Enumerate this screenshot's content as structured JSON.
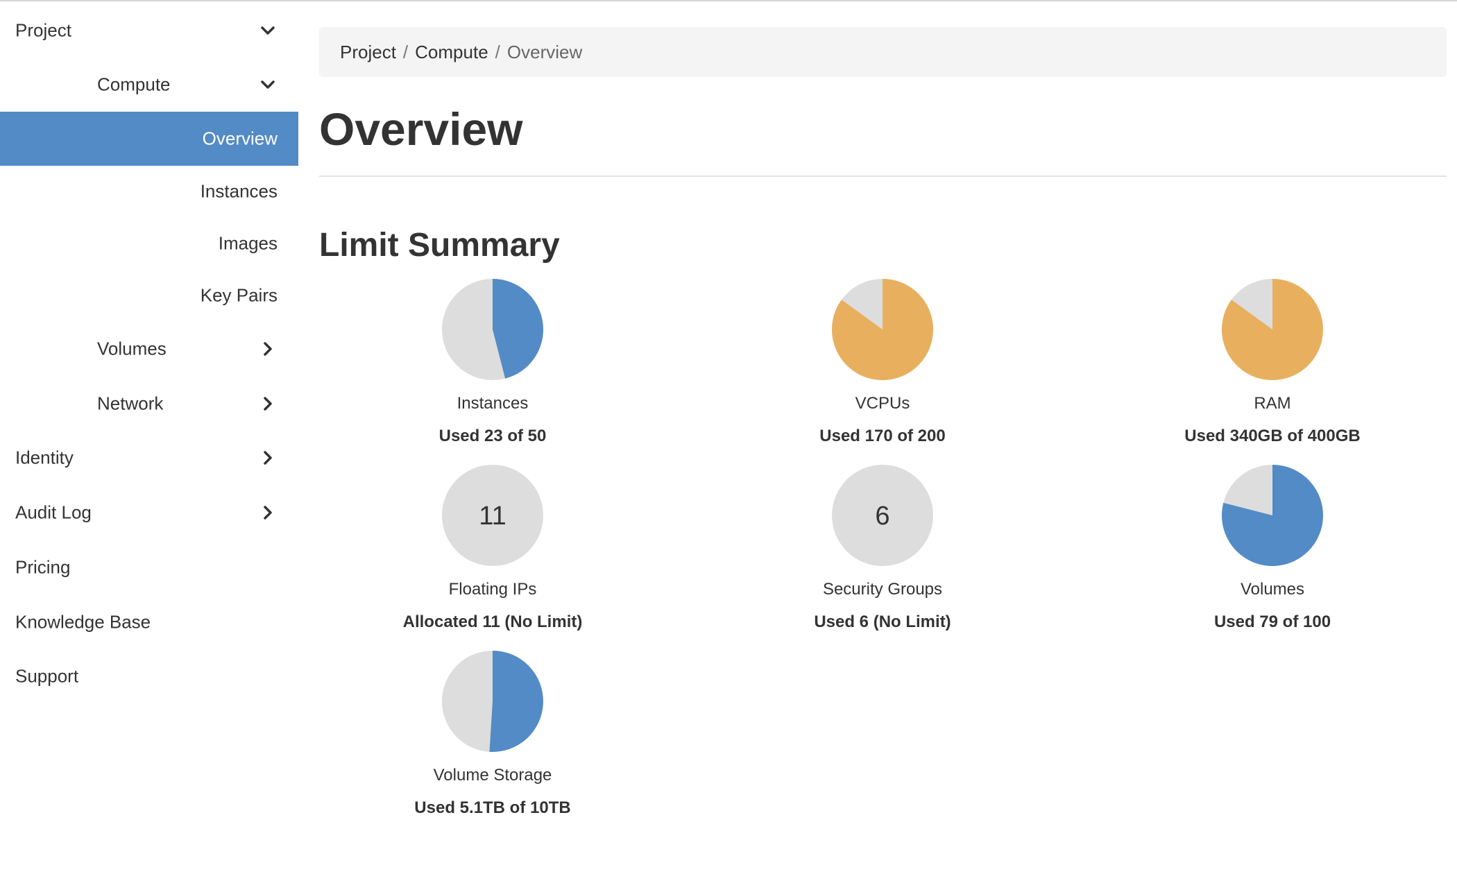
{
  "sidebar": {
    "items": [
      {
        "id": "project",
        "label": "Project",
        "icon": "chevron-down-icon"
      },
      {
        "id": "compute",
        "label": "Compute",
        "icon": "chevron-down-icon"
      },
      {
        "id": "overview",
        "label": "Overview",
        "active": true
      },
      {
        "id": "instances",
        "label": "Instances"
      },
      {
        "id": "images",
        "label": "Images"
      },
      {
        "id": "key-pairs",
        "label": "Key Pairs"
      },
      {
        "id": "volumes",
        "label": "Volumes",
        "icon": "chevron-right-icon"
      },
      {
        "id": "network",
        "label": "Network",
        "icon": "chevron-right-icon"
      },
      {
        "id": "identity",
        "label": "Identity",
        "icon": "chevron-right-icon"
      },
      {
        "id": "audit-log",
        "label": "Audit Log",
        "icon": "chevron-right-icon"
      },
      {
        "id": "pricing",
        "label": "Pricing"
      },
      {
        "id": "knowledge-base",
        "label": "Knowledge Base"
      },
      {
        "id": "support",
        "label": "Support"
      }
    ]
  },
  "breadcrumb": {
    "items": [
      "Project",
      "Compute"
    ],
    "current": "Overview",
    "separator": "/"
  },
  "page": {
    "title": "Overview",
    "section_heading": "Limit Summary"
  },
  "colors": {
    "accent": "#538bc6",
    "warning": "#e8b05e",
    "empty": "#dddddd",
    "text": "#333333"
  },
  "chart_data": {
    "type": "pie",
    "charts": [
      {
        "label": "Instances",
        "usage": "Used 23 of 50",
        "used": 23,
        "limit": 50
      },
      {
        "label": "VCPUs",
        "usage": "Used 170 of 200",
        "used": 170,
        "limit": 200
      },
      {
        "label": "RAM",
        "usage": "Used 340GB of 400GB",
        "used": 340,
        "limit": 400
      },
      {
        "label": "Floating IPs",
        "usage": "Allocated 11 (No Limit)",
        "used": 11,
        "limit": null,
        "center_text": "11"
      },
      {
        "label": "Security Groups",
        "usage": "Used 6 (No Limit)",
        "used": 6,
        "limit": null,
        "center_text": "6"
      },
      {
        "label": "Volumes",
        "usage": "Used 79 of 100",
        "used": 79,
        "limit": 100
      },
      {
        "label": "Volume Storage",
        "usage": "Used 5.1TB of 10TB",
        "used": 5.1,
        "limit": 10
      }
    ]
  }
}
